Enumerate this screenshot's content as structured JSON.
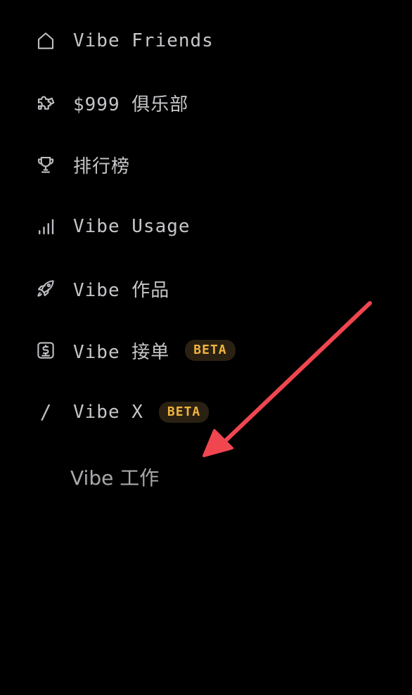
{
  "nav": {
    "items": [
      {
        "label": "Vibe Friends",
        "icon": "home-icon"
      },
      {
        "label": "$999 俱乐部",
        "icon": "puzzle-icon"
      },
      {
        "label": "排行榜",
        "icon": "trophy-icon"
      },
      {
        "label": "Vibe Usage",
        "icon": "bar-chart-icon"
      },
      {
        "label": "Vibe 作品",
        "icon": "rocket-icon"
      },
      {
        "label": "Vibe 接单",
        "icon": "dollar-receipt-icon",
        "badge": "BETA"
      },
      {
        "label": "Vibe X",
        "icon": "slash-icon",
        "icon_glyph": "/",
        "badge": "BETA"
      }
    ],
    "sub_item": {
      "label": "Vibe 工作"
    }
  },
  "colors": {
    "background": "#000000",
    "text": "#c6c6ca",
    "badge_text": "#f0b43c",
    "badge_bg": "#2b2112",
    "arrow": "#f0464f"
  }
}
